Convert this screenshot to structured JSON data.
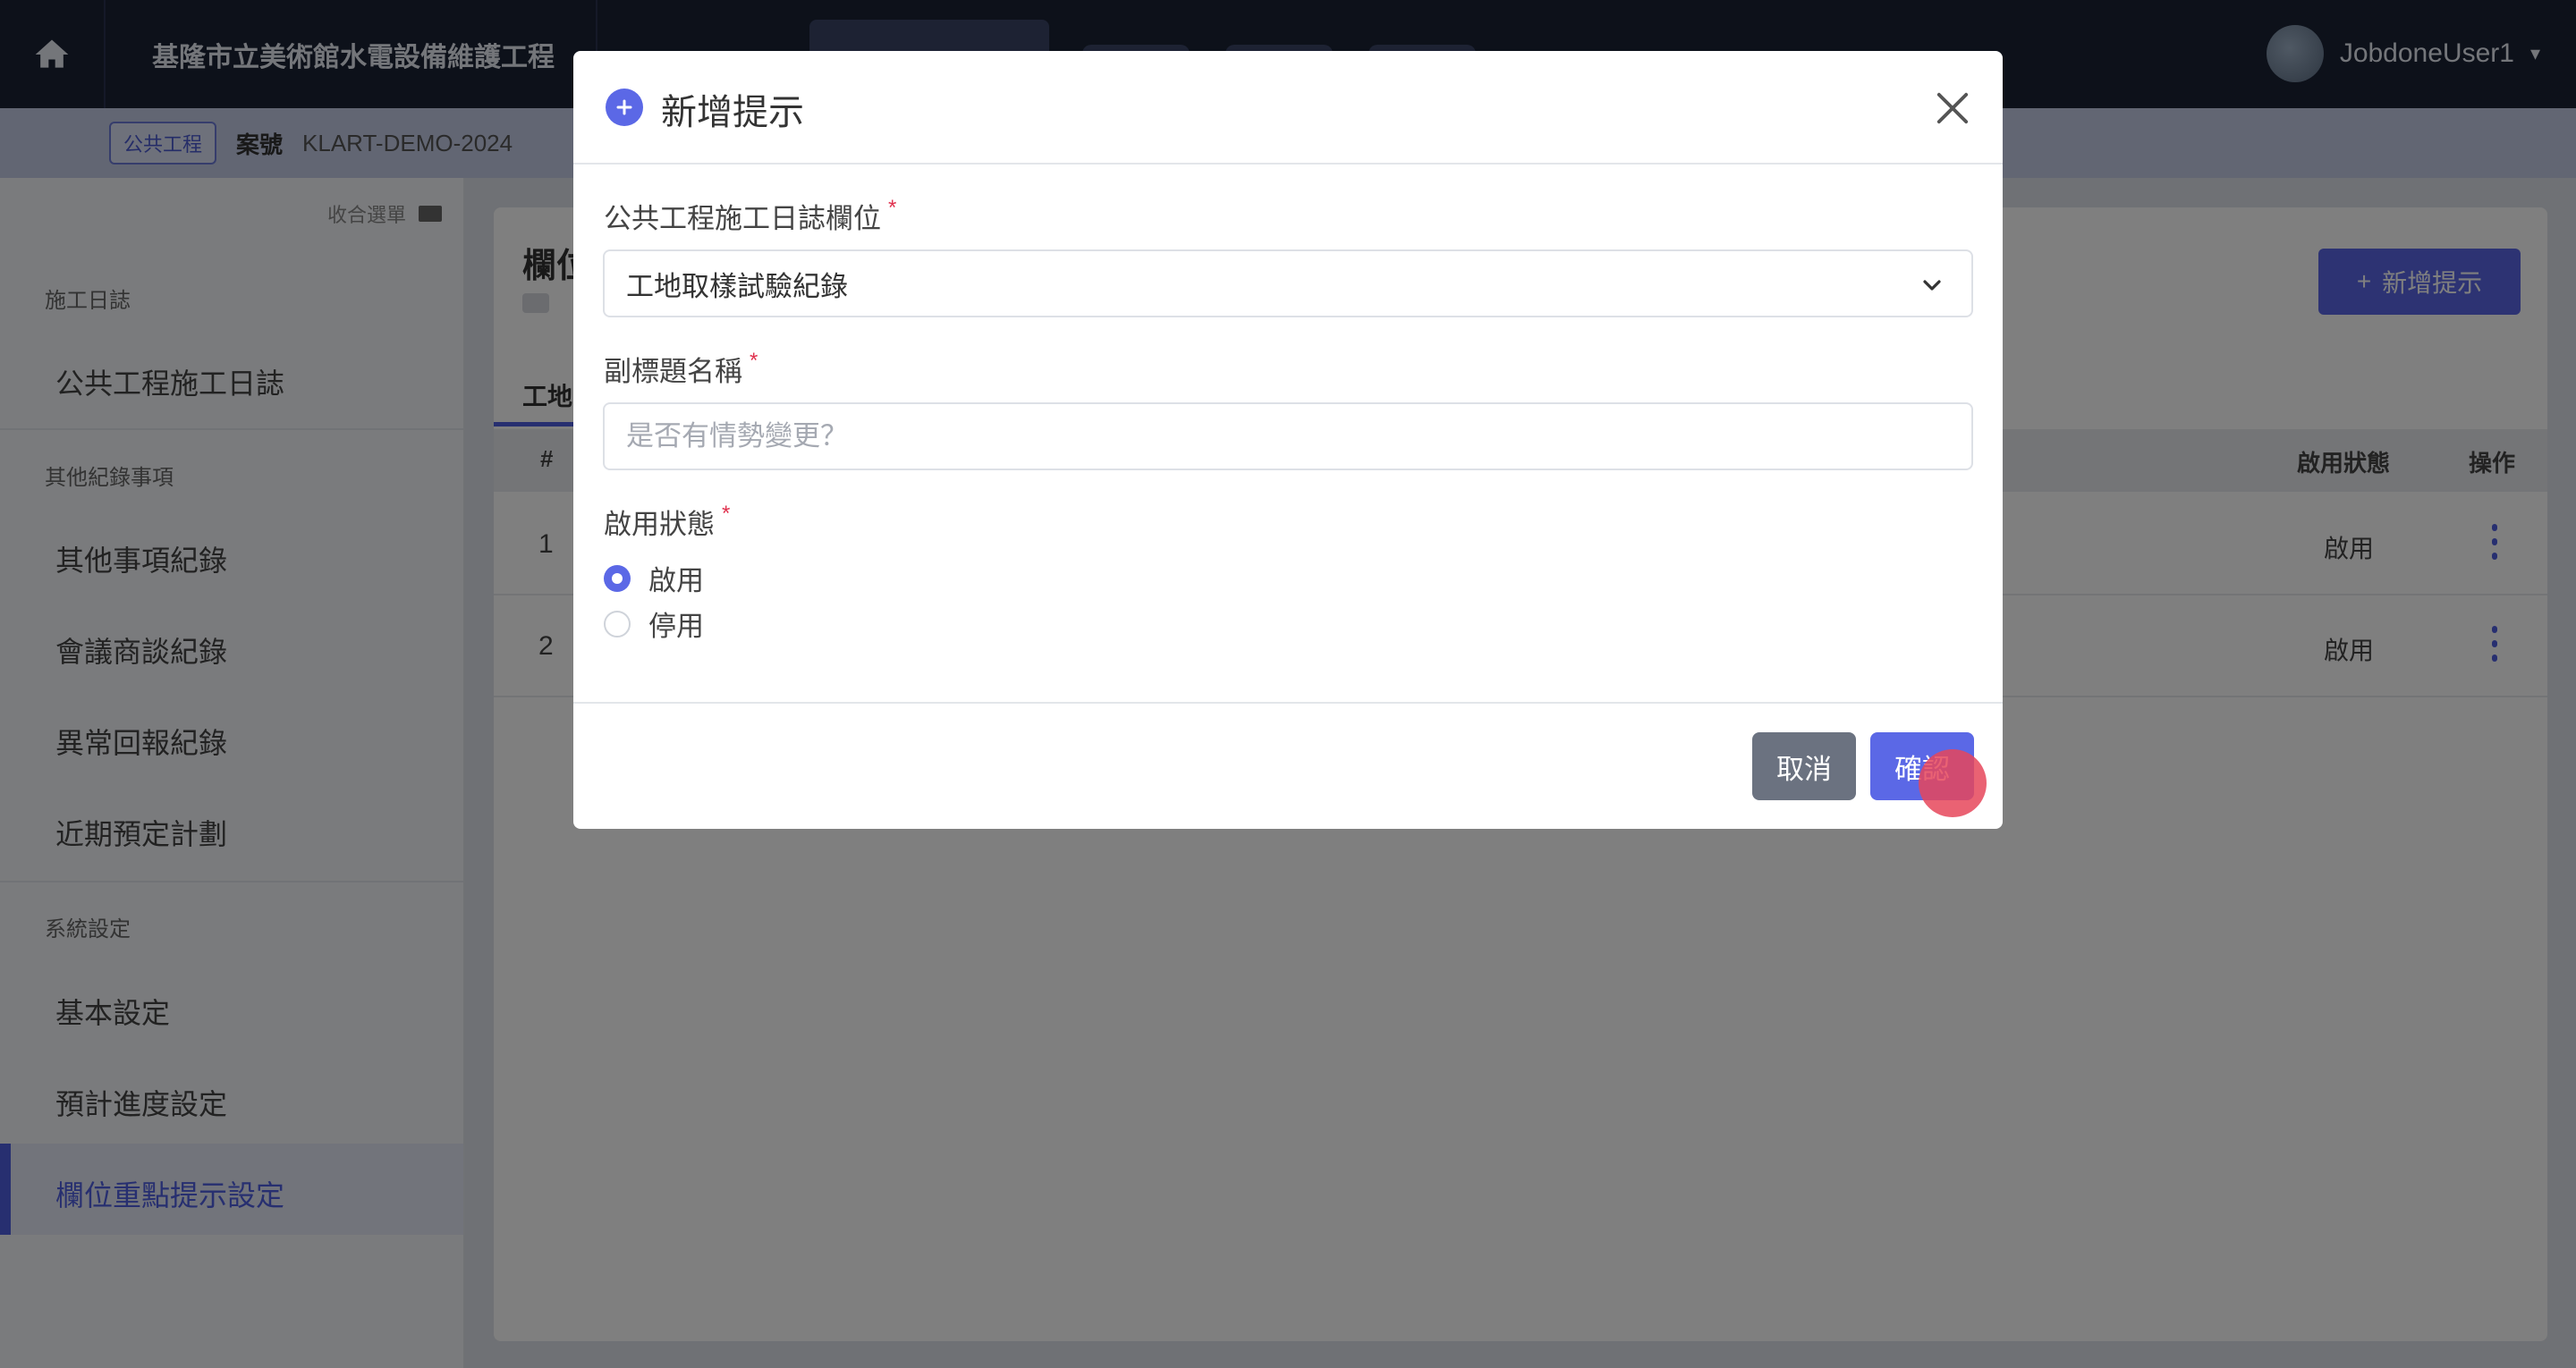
{
  "topbar": {
    "project_title": "基隆市立美術館水電設備維護工程",
    "user_name": "JobdoneUser1",
    "home_icon": "home-icon"
  },
  "subbar": {
    "badge": "公共工程",
    "project_label": "案號",
    "project_value": "KLART-DEMO-2024"
  },
  "sidebar": {
    "collapse_label": "收合選單",
    "sections": [
      {
        "title": "施工日誌",
        "items": [
          "公共工程施工日誌"
        ]
      },
      {
        "title": "其他紀錄事項",
        "items": [
          "其他事項紀錄",
          "會議商談紀錄",
          "異常回報紀錄",
          "近期預定計劃"
        ]
      },
      {
        "title": "系統設定",
        "items": [
          "基本設定",
          "預計進度設定",
          "欄位重點提示設定"
        ]
      }
    ]
  },
  "content": {
    "title": "欄位",
    "add_button": "新增提示",
    "tab": "工地",
    "table": {
      "headers": {
        "index": "#",
        "status": "啟用狀態",
        "operation": "操作"
      },
      "rows": [
        {
          "index": "1",
          "status": "啟用"
        },
        {
          "index": "2",
          "status": "啟用"
        }
      ]
    }
  },
  "modal": {
    "title": "新增提示",
    "field_column_label": "公共工程施工日誌欄位",
    "field_column_value": "工地取樣試驗紀錄",
    "subtitle_label": "副標題名稱",
    "subtitle_placeholder": "是否有情勢變更？",
    "subtitle_value": "",
    "status_label": "啟用狀態",
    "required_mark": "*",
    "status_options": [
      {
        "label": "啟用",
        "checked": true
      },
      {
        "label": "停用",
        "checked": false
      }
    ],
    "cancel_label": "取消",
    "confirm_label": "確認"
  },
  "colors": {
    "primary": "#5b68e6",
    "required": "#e0314e",
    "cancel": "#6b7280",
    "topbar": "#1a2235"
  }
}
